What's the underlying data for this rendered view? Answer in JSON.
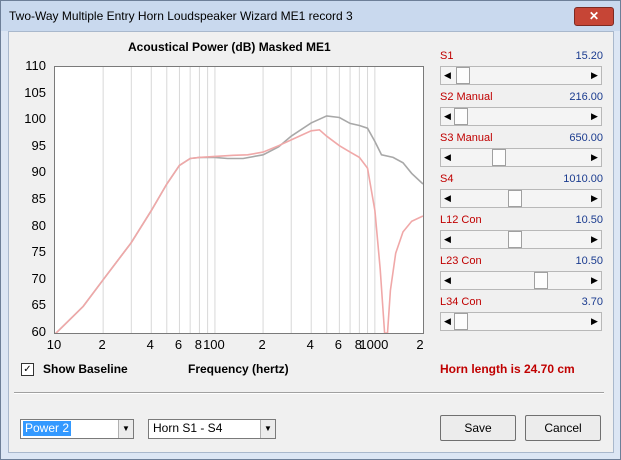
{
  "window": {
    "title": "Two-Way Multiple Entry Horn Loudspeaker Wizard   ME1 record 3",
    "close_glyph": "✕"
  },
  "chart_title": "Acoustical Power (dB)   Masked   ME1",
  "chart_data": {
    "type": "line",
    "title": "Acoustical Power (dB)   Masked   ME1",
    "xlabel": "Frequency (hertz)",
    "ylabel": "",
    "x_scale": "log",
    "xlim": [
      10,
      2000
    ],
    "ylim": [
      60,
      110
    ],
    "y_ticks": [
      "110",
      "105",
      "100",
      "95",
      "90",
      "85",
      "80",
      "75",
      "70",
      "65",
      "60"
    ],
    "x_ticks": [
      {
        "value": 10,
        "label": "10"
      },
      {
        "value": 20,
        "label": "2"
      },
      {
        "value": 40,
        "label": "4"
      },
      {
        "value": 60,
        "label": "6"
      },
      {
        "value": 80,
        "label": "8"
      },
      {
        "value": 100,
        "label": "100"
      },
      {
        "value": 200,
        "label": "2"
      },
      {
        "value": 400,
        "label": "4"
      },
      {
        "value": 600,
        "label": "6"
      },
      {
        "value": 800,
        "label": "8"
      },
      {
        "value": 1000,
        "label": "1000"
      },
      {
        "value": 2000,
        "label": "2"
      }
    ],
    "grid": true,
    "series": [
      {
        "color": "#a8a8a8",
        "points": [
          [
            10,
            59.8
          ],
          [
            15,
            65
          ],
          [
            20,
            70
          ],
          [
            30,
            77
          ],
          [
            40,
            83
          ],
          [
            50,
            88
          ],
          [
            60,
            91.5
          ],
          [
            70,
            92.8
          ],
          [
            80,
            93
          ],
          [
            100,
            93
          ],
          [
            120,
            92.8
          ],
          [
            150,
            92.8
          ],
          [
            200,
            93.5
          ],
          [
            250,
            95
          ],
          [
            300,
            97
          ],
          [
            400,
            99.5
          ],
          [
            500,
            100.8
          ],
          [
            600,
            100.5
          ],
          [
            700,
            99.4
          ],
          [
            800,
            99
          ],
          [
            900,
            98.5
          ],
          [
            1000,
            96
          ],
          [
            1100,
            93.5
          ],
          [
            1300,
            93
          ],
          [
            1500,
            92
          ],
          [
            1700,
            90
          ],
          [
            2000,
            88
          ]
        ]
      },
      {
        "color": "#f0a8a8",
        "points": [
          [
            10,
            59.8
          ],
          [
            15,
            65
          ],
          [
            20,
            70
          ],
          [
            30,
            77
          ],
          [
            40,
            83
          ],
          [
            50,
            88
          ],
          [
            60,
            91.5
          ],
          [
            70,
            92.8
          ],
          [
            80,
            93
          ],
          [
            100,
            93.2
          ],
          [
            130,
            93.4
          ],
          [
            160,
            93.5
          ],
          [
            200,
            94
          ],
          [
            250,
            95.2
          ],
          [
            300,
            96.3
          ],
          [
            400,
            98
          ],
          [
            450,
            98.2
          ],
          [
            500,
            97
          ],
          [
            600,
            95.2
          ],
          [
            700,
            94
          ],
          [
            800,
            93
          ],
          [
            900,
            91
          ],
          [
            1000,
            83
          ],
          [
            1080,
            72
          ],
          [
            1150,
            60
          ],
          [
            1200,
            60
          ],
          [
            1250,
            68
          ],
          [
            1350,
            75
          ],
          [
            1500,
            79
          ],
          [
            1700,
            81
          ],
          [
            2000,
            82
          ]
        ]
      }
    ]
  },
  "sliders": [
    {
      "label": "S1",
      "value": "15.20",
      "thumb": 0.02
    },
    {
      "label": "S2  Manual",
      "value": "216.00",
      "thumb": 0.0
    },
    {
      "label": "S3  Manual",
      "value": "650.00",
      "thumb": 0.32
    },
    {
      "label": "S4",
      "value": "1010.00",
      "thumb": 0.45
    },
    {
      "label": "L12  Con",
      "value": "10.50",
      "thumb": 0.45
    },
    {
      "label": "L23  Con",
      "value": "10.50",
      "thumb": 0.67
    },
    {
      "label": "L34  Con",
      "value": "3.70",
      "thumb": 0.0
    }
  ],
  "horn_length": "Horn length is 24.70 cm",
  "show_baseline": {
    "label": "Show Baseline",
    "checked": true,
    "glyph": "✓"
  },
  "freq_label": "Frequency (hertz)",
  "combo1": {
    "value": "Power 2"
  },
  "combo2": {
    "value": "Horn S1 - S4"
  },
  "buttons": {
    "save": "Save",
    "cancel": "Cancel"
  },
  "icons": {
    "left_arrow": "◀",
    "right_arrow": "▶",
    "dropdown": "▼"
  }
}
